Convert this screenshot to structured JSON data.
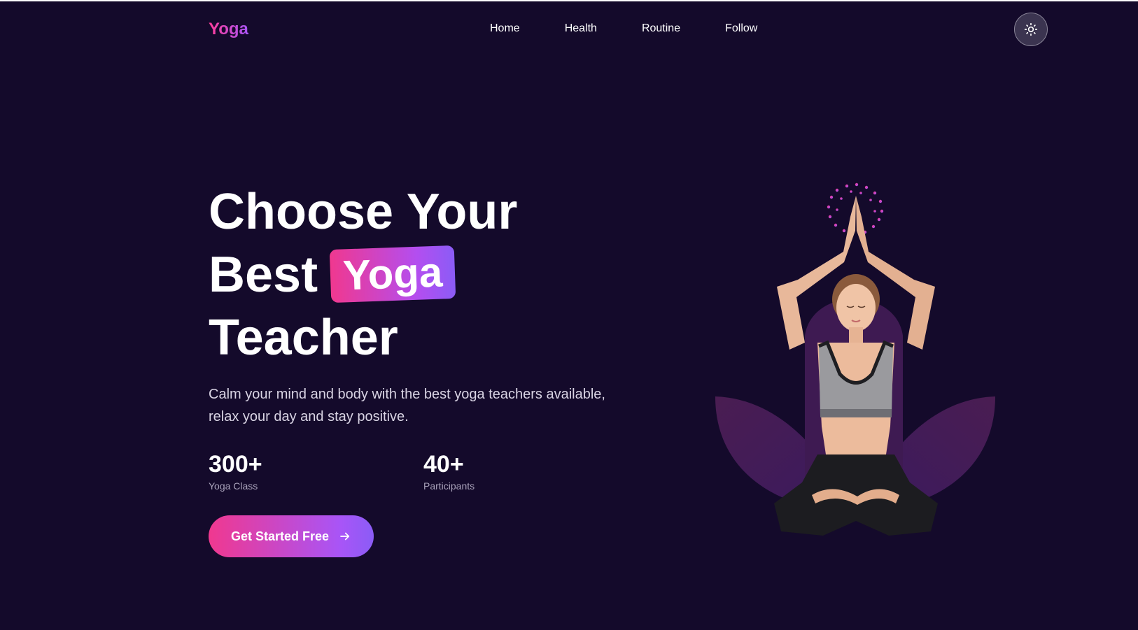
{
  "header": {
    "logo": "Yoga",
    "nav": [
      "Home",
      "Health",
      "Routine",
      "Follow"
    ],
    "theme_icon": "sun-icon"
  },
  "hero": {
    "headline_line1": "Choose Your",
    "headline_line2": "Best",
    "headline_highlight": "Yoga",
    "headline_line3": "Teacher",
    "description": "Calm your mind and body with the best yoga teachers available, relax your day and stay positive.",
    "stats": [
      {
        "value": "300+",
        "label": "Yoga Class"
      },
      {
        "value": "40+",
        "label": "Participants"
      }
    ],
    "cta_label": "Get Started Free",
    "cta_icon": "arrow-right-icon"
  },
  "colors": {
    "background": "#140a2b",
    "accent_pink": "#f0388f",
    "accent_purple": "#a855f7"
  }
}
